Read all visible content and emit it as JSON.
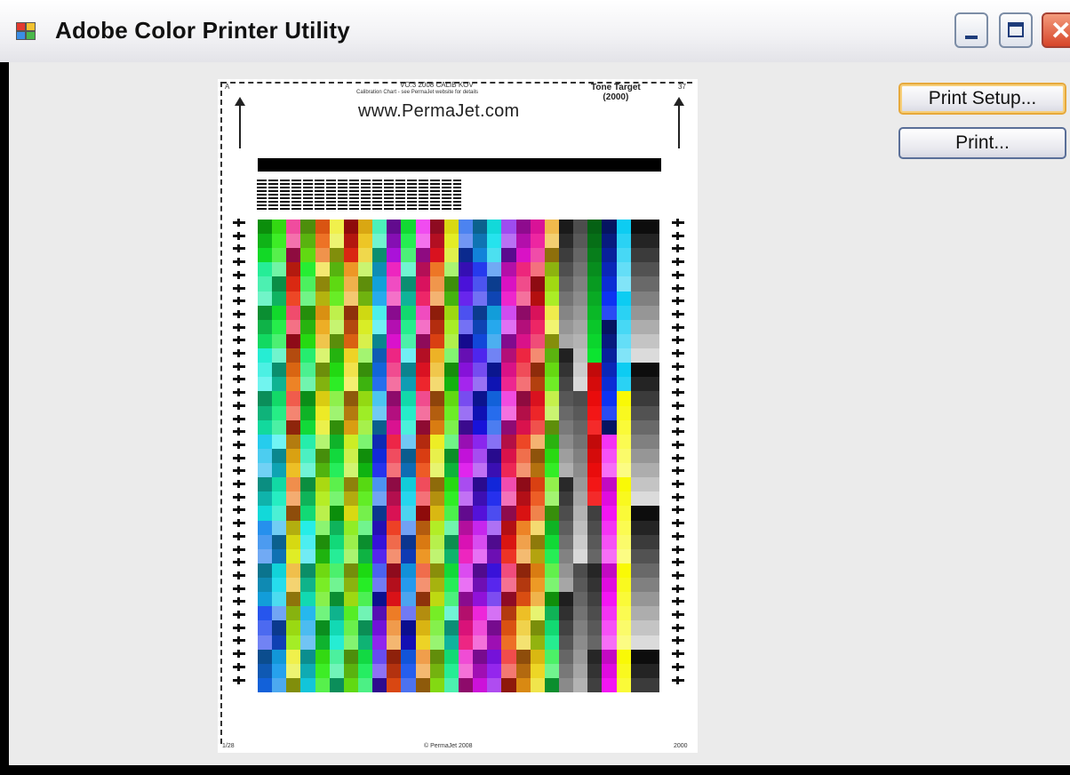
{
  "window": {
    "title": "Adobe Color Printer Utility",
    "controls": [
      "minimize",
      "maximize",
      "close"
    ]
  },
  "buttons": {
    "print_setup": "Print Setup...",
    "print": "Print..."
  },
  "preview": {
    "header_code": "VO.3 2008 CALIB KOV",
    "header_sub": "Calibration Chart - see PermaJet website for details",
    "url": "www.PermaJet.com",
    "target_label": "Tone Target",
    "target_count": "(2000)",
    "corner_top_left": "A",
    "corner_top_right": "37",
    "footer_left": "1/28",
    "footer_center": "© PermaJet 2008",
    "footer_right": "2000"
  },
  "colors": {
    "titlebar": "#f1f1f4",
    "client": "#ebebeb",
    "button_border": "#5a6f98",
    "focus_border": "#e6a93c",
    "close_button": "#d6452a"
  }
}
